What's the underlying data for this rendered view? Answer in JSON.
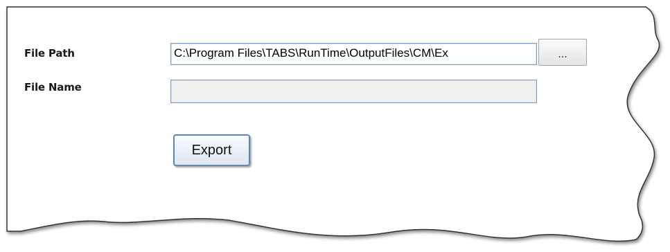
{
  "form": {
    "file_path_label": "File Path",
    "file_path_value": "C:\\Program Files\\TABS\\RunTime\\OutputFiles\\CM\\Ex",
    "browse_label": "...",
    "file_name_label": "File Name",
    "file_name_value": "",
    "export_label": "Export"
  },
  "colors": {
    "input_border": "#7f9db9",
    "export_border": "#5a86b8",
    "disabled_input_bg": "#f0f0f0"
  }
}
